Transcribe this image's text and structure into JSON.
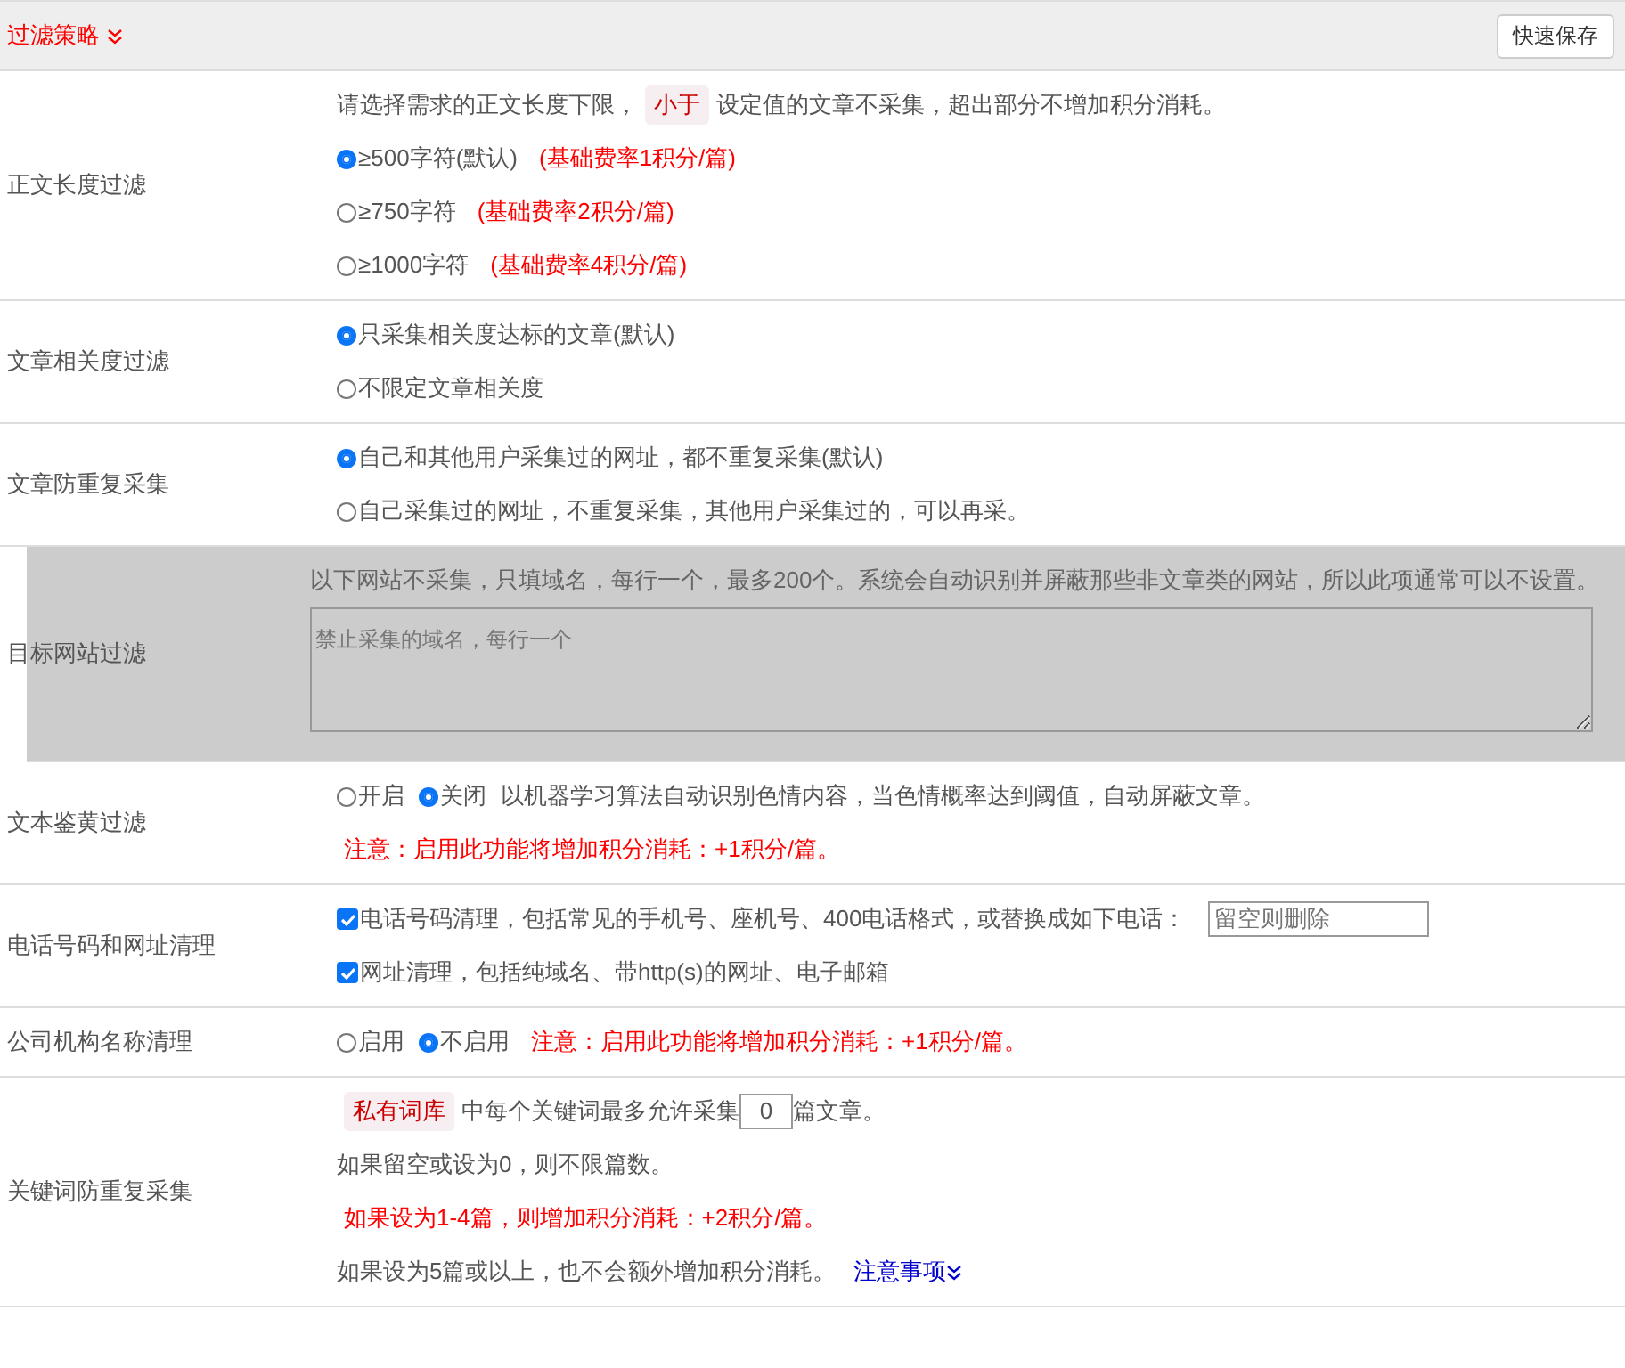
{
  "header": {
    "title": "过滤策略",
    "button": "快速保存"
  },
  "rows": [
    {
      "label": "正文长度过滤",
      "highlighted": false,
      "lines": [
        [
          {
            "kind": "text",
            "text": "请选择需求的正文长度下限，"
          },
          {
            "kind": "tag",
            "text": "小于"
          },
          {
            "kind": "text",
            "text": "设定值的文章不采集，超出部分不增加积分消耗。"
          }
        ],
        [
          {
            "kind": "radio",
            "text": "≥500字符(默认)",
            "selected": true
          },
          {
            "kind": "red",
            "text": "(基础费率1积分/篇)"
          }
        ],
        [
          {
            "kind": "radio",
            "text": "≥750字符",
            "selected": false
          },
          {
            "kind": "red",
            "text": "(基础费率2积分/篇)"
          }
        ],
        [
          {
            "kind": "radio",
            "text": "≥1000字符",
            "selected": false
          },
          {
            "kind": "red",
            "text": "(基础费率4积分/篇)"
          }
        ]
      ]
    },
    {
      "label": "文章相关度过滤",
      "highlighted": false,
      "lines": [
        [
          {
            "kind": "radio",
            "text": "只采集相关度达标的文章(默认)",
            "selected": true
          }
        ],
        [
          {
            "kind": "radio",
            "text": "不限定文章相关度",
            "selected": false
          }
        ]
      ]
    },
    {
      "label": "文章防重复采集",
      "highlighted": false,
      "lines": [
        [
          {
            "kind": "radio",
            "text": "自己和其他用户采集过的网址，都不重复采集(默认)",
            "selected": true
          }
        ],
        [
          {
            "kind": "radio",
            "text": "自己采集过的网址，不重复采集，其他用户采集过的，可以再采。",
            "selected": false
          }
        ]
      ]
    },
    {
      "label": "目标网站过滤",
      "highlighted": true,
      "lines": [
        [
          {
            "kind": "text",
            "text": "以下网站不采集，只填域名，每行一个，最多200个。系统会自动识别并屏蔽那些非文章类的网站，所以此项通常可以不设置。"
          }
        ],
        [
          {
            "kind": "textarea",
            "placeholder": "禁止采集的域名，每行一个"
          }
        ]
      ]
    },
    {
      "label": "文本鉴黄过滤",
      "highlighted": false,
      "lines": [
        [
          {
            "kind": "radio",
            "text": "开启",
            "selected": false
          },
          {
            "kind": "radio",
            "text": "关闭",
            "selected": true
          },
          {
            "kind": "text",
            "text": "以机器学习算法自动识别色情内容，当色情概率达到阈值，自动屏蔽文章。"
          }
        ],
        [
          {
            "kind": "red",
            "text": "注意：启用此功能将增加积分消耗：+1积分/篇。"
          }
        ]
      ]
    },
    {
      "label": "电话号码和网址清理",
      "highlighted": false,
      "lines": [
        [
          {
            "kind": "checkbox",
            "text": "电话号码清理，包括常见的手机号、座机号、400电话格式，或替换成如下电话：",
            "checked": true
          },
          {
            "kind": "input",
            "placeholder": "留空则删除"
          }
        ],
        [
          {
            "kind": "checkbox",
            "text": "网址清理，包括纯域名、带http(s)的网址、电子邮箱",
            "checked": true
          }
        ]
      ]
    },
    {
      "label": "公司机构名称清理",
      "highlighted": false,
      "lines": [
        [
          {
            "kind": "radio",
            "text": "启用",
            "selected": false
          },
          {
            "kind": "radio",
            "text": "不启用",
            "selected": true
          },
          {
            "kind": "red",
            "text": "注意：启用此功能将增加积分消耗：+1积分/篇。"
          }
        ]
      ]
    },
    {
      "label": "关键词防重复采集",
      "highlighted": false,
      "lines": [
        [
          {
            "kind": "tag",
            "text": "私有词库"
          },
          {
            "kind": "text",
            "text": "中每个关键词最多允许采集"
          },
          {
            "kind": "number",
            "value": "0"
          },
          {
            "kind": "text",
            "text": "篇文章。"
          }
        ],
        [
          {
            "kind": "text",
            "text": "如果留空或设为0，则不限篇数。"
          }
        ],
        [
          {
            "kind": "red",
            "text": "如果设为1-4篇，则增加积分消耗：+2积分/篇。"
          }
        ],
        [
          {
            "kind": "text",
            "text": "如果设为5篇或以上，也不会额外增加积分消耗。"
          },
          {
            "kind": "link",
            "text": "注意事项"
          }
        ]
      ]
    }
  ]
}
